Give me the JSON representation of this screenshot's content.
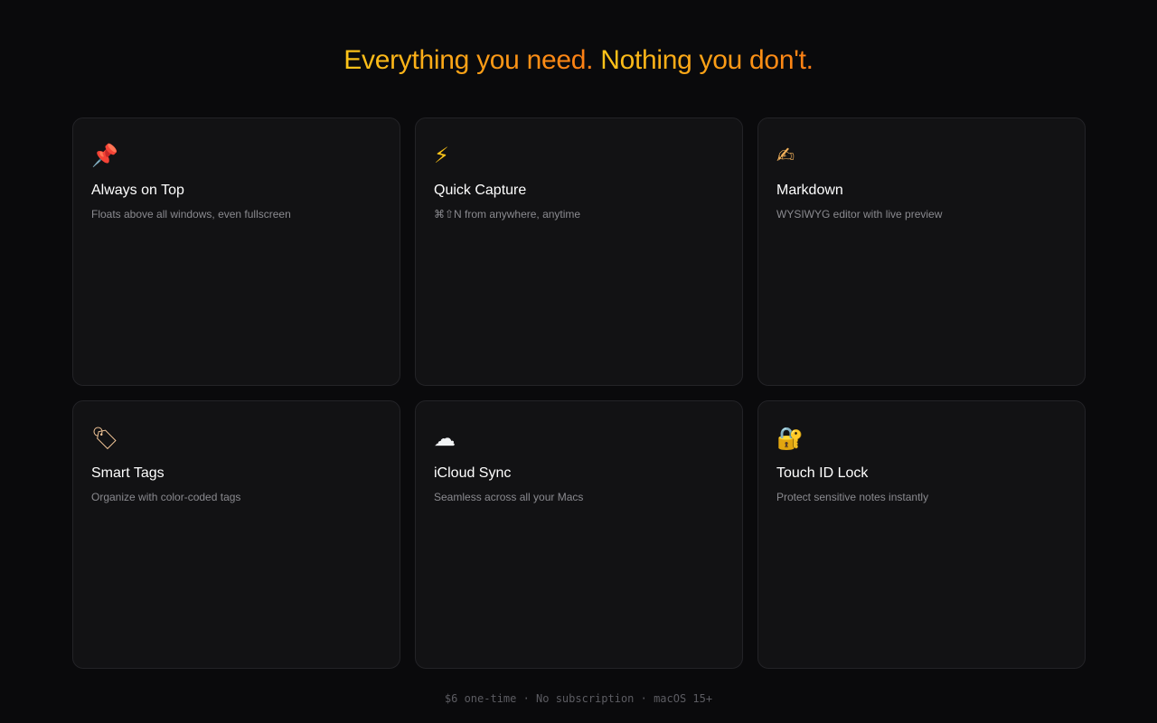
{
  "headline": {
    "part1": "Everything you need.",
    "part2": "Nothing you don't."
  },
  "features": [
    {
      "icon": "pushpin-icon",
      "glyph": "📌",
      "title": "Always on Top",
      "description": "Floats above all windows, even fullscreen"
    },
    {
      "icon": "lightning-icon",
      "glyph": "⚡",
      "title": "Quick Capture",
      "description": "⌘⇧N from anywhere, anytime"
    },
    {
      "icon": "writing-hand-icon",
      "glyph": "✍",
      "title": "Markdown",
      "description": "WYSIWYG editor with live preview"
    },
    {
      "icon": "tag-icon",
      "glyph": "🏷",
      "title": "Smart Tags",
      "description": "Organize with color-coded tags"
    },
    {
      "icon": "cloud-icon",
      "glyph": "☁",
      "title": "iCloud Sync",
      "description": "Seamless across all your Macs"
    },
    {
      "icon": "lock-key-icon",
      "glyph": "🔐",
      "title": "Touch ID Lock",
      "description": "Protect sensitive notes instantly"
    }
  ],
  "footer": {
    "text": "$6 one-time · No subscription · macOS 15+"
  },
  "colors": {
    "background": "#0a0a0c",
    "card": "#121214",
    "accent_start": "#fcc419",
    "accent_end": "#fd7e14"
  }
}
